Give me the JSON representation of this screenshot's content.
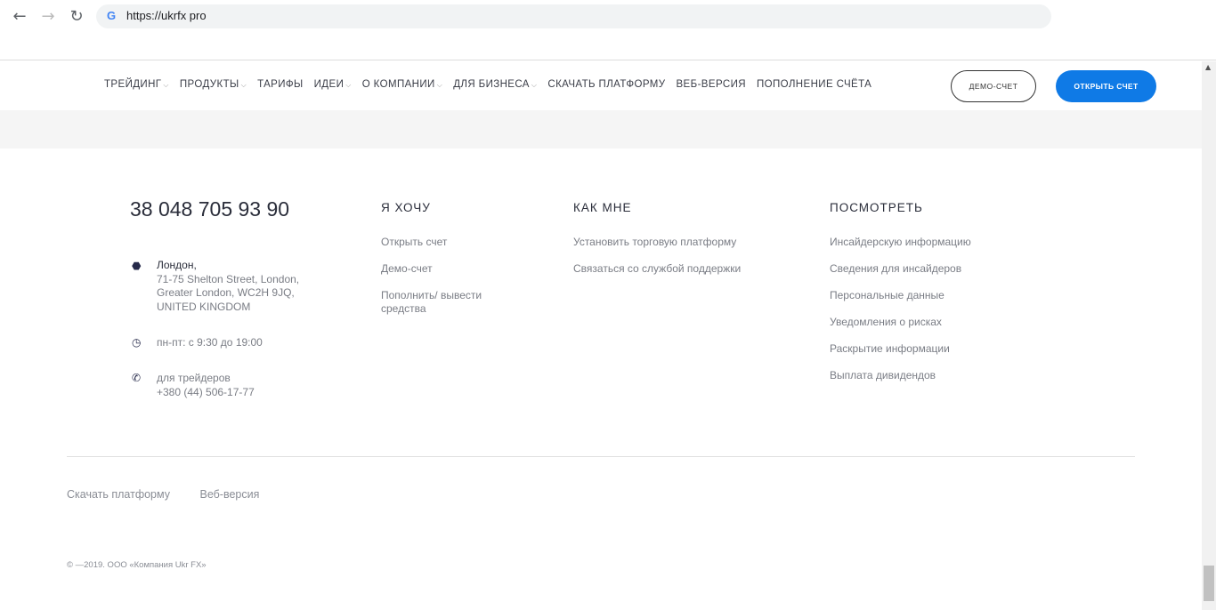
{
  "browser": {
    "url": "https://ukrfx pro",
    "back_icon": "arrow-left",
    "forward_icon": "arrow-right",
    "reload_icon": "reload"
  },
  "nav": {
    "items": [
      {
        "label": "ТРЕЙДИНГ",
        "dropdown": true
      },
      {
        "label": "ПРОДУКТЫ",
        "dropdown": true
      },
      {
        "label": "ТАРИФЫ",
        "dropdown": false
      },
      {
        "label": "ИДЕИ",
        "dropdown": true
      },
      {
        "label": "О КОМПАНИИ",
        "dropdown": true
      },
      {
        "label": "ДЛЯ БИЗНЕСА",
        "dropdown": true
      },
      {
        "label": "СКАЧАТЬ ПЛАТФОРМУ",
        "dropdown": false
      },
      {
        "label": "ВЕБ-ВЕРСИЯ",
        "dropdown": false
      },
      {
        "label": "ПОПОЛНЕНИЕ СЧЁТА",
        "dropdown": false
      }
    ],
    "demo_label": "ДЕМО-СЧЕТ",
    "open_label": "ОТКРЫТЬ СЧЕТ",
    "accent": "#0f7ae6"
  },
  "contact": {
    "phone": "38 048 705 93 90",
    "city": "Лондон,",
    "address": [
      "71-75 Shelton Street, London,",
      "Greater London, WC2H 9JQ,",
      "UNITED KINGDOM"
    ],
    "hours": "пн-пт: с 9:30 до 19:00",
    "traders_label": "для трейдеров",
    "traders_phone": "+380 (44) 506-17-77"
  },
  "columns": [
    {
      "title": "Я ХОЧУ",
      "links": [
        "Открыть счет",
        "Демо-счет",
        "Пополнить/ вывести средства"
      ]
    },
    {
      "title": "КАК МНЕ",
      "links": [
        "Установить торговую платформу",
        "Связаться со службой поддержки"
      ]
    },
    {
      "title": "ПОСМОТРЕТЬ",
      "links": [
        "Инсайдерскую информацию",
        "Сведения для инсайдеров",
        "Персональные данные",
        "Уведомления о рисках",
        "Раскрытие информации",
        "Выплата дивидендов"
      ]
    }
  ],
  "bottom_links": [
    "Скачать платформу",
    "Веб-версия"
  ],
  "copyright": "© —2019. ООО «Компания Ukr FX»"
}
